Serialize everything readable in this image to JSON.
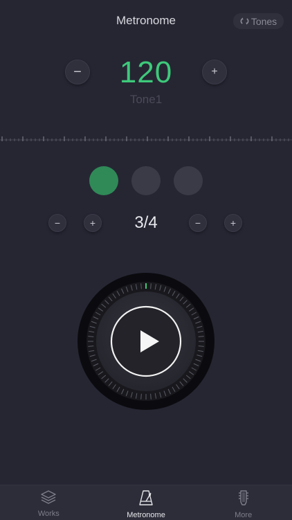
{
  "header": {
    "title": "Metronome",
    "tones_label": "Tones"
  },
  "tempo": {
    "bpm": "120",
    "tone": "Tone1",
    "decrease_label": "−",
    "increase_label": "+"
  },
  "beats": {
    "count": 3,
    "active_index": 0,
    "accent_color": "#2f8a57"
  },
  "time_signature": {
    "value": "3/4",
    "beats_decrease": "−",
    "beats_increase": "+",
    "note_decrease": "−",
    "note_increase": "+"
  },
  "player": {
    "state": "stopped",
    "icon": "play-icon"
  },
  "tabbar": {
    "tabs": [
      {
        "label": "Works",
        "icon": "layers-icon",
        "active": false
      },
      {
        "label": "Metronome",
        "icon": "metronome-icon",
        "active": true
      },
      {
        "label": "More",
        "icon": "guitar-headstock-icon",
        "active": false
      }
    ]
  },
  "colors": {
    "background": "#262633",
    "accent": "#3ec97a",
    "button": "#30303d"
  }
}
